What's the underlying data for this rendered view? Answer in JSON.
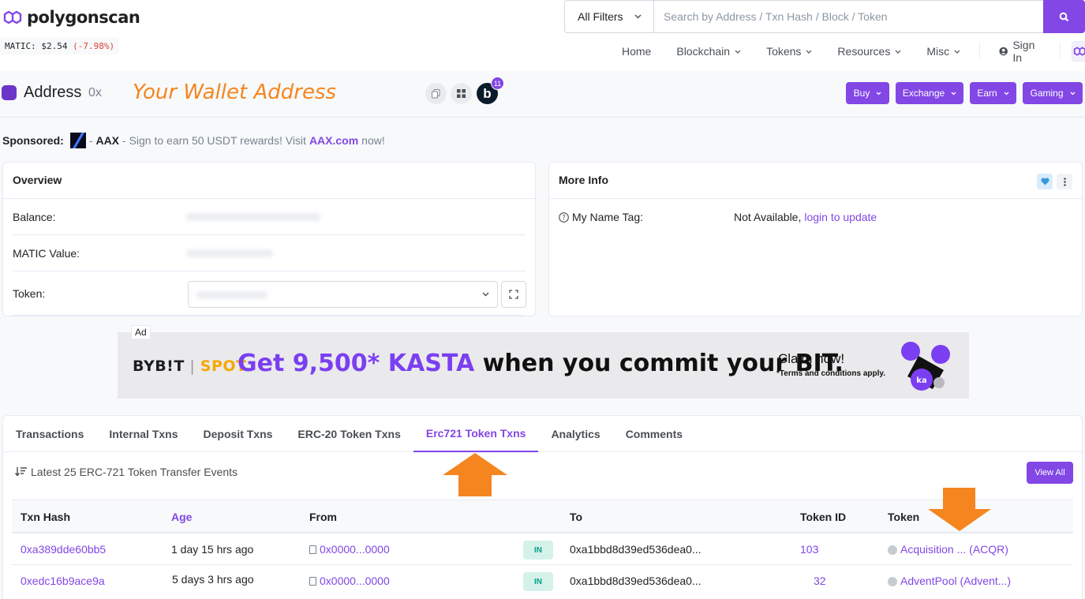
{
  "header": {
    "logo_text": "polygonscan",
    "price_label": "MATIC: $2.54",
    "price_change": "(-7.98%)",
    "filter_label": "All Filters",
    "search_placeholder": "Search by Address / Txn Hash / Block / Token",
    "nav": [
      {
        "label": "Home"
      },
      {
        "label": "Blockchain"
      },
      {
        "label": "Tokens"
      },
      {
        "label": "Resources"
      },
      {
        "label": "Misc"
      }
    ],
    "sign_in": "Sign In"
  },
  "title": {
    "label": "Address",
    "hash_prefix": "0x",
    "annotation": "Your Wallet Address",
    "blockscan_letter": "b",
    "blockscan_badge": "11",
    "buttons": [
      "Buy",
      "Exchange",
      "Earn",
      "Gaming"
    ]
  },
  "sponsored": {
    "label": "Sponsored:",
    "brand": "AAX",
    "text": "- Sign to earn 50 USDT rewards! Visit",
    "link": "AAX.com",
    "suffix": "now!"
  },
  "overview": {
    "title": "Overview",
    "balance_label": "Balance:",
    "matic_value_label": "MATIC Value:",
    "token_label": "Token:"
  },
  "more_info": {
    "title": "More Info",
    "name_tag_label": "My Name Tag:",
    "name_tag_value": "Not Available,",
    "name_tag_link": "login to update"
  },
  "ad": {
    "label": "Ad",
    "brand": "BYB!T",
    "brand_sub": "SPOT",
    "headline_highlight": "Get 9,500* KASTA",
    "headline_rest": "when you commit your BIT.",
    "claim": "Claim now!",
    "terms": "*Terms and conditions apply."
  },
  "tabs": [
    {
      "label": "Transactions",
      "active": false
    },
    {
      "label": "Internal Txns",
      "active": false
    },
    {
      "label": "Deposit Txns",
      "active": false
    },
    {
      "label": "ERC-20 Token Txns",
      "active": false
    },
    {
      "label": "Erc721 Token Txns",
      "active": true
    },
    {
      "label": "Analytics",
      "active": false
    },
    {
      "label": "Comments",
      "active": false
    }
  ],
  "table": {
    "caption": "Latest 25 ERC-721 Token Transfer Events",
    "view_all": "View All",
    "columns": [
      "Txn Hash",
      "Age",
      "From",
      "To",
      "Token ID",
      "Token"
    ],
    "rows": [
      {
        "hash": "0xa389dde60bb5",
        "age": "1 day 15 hrs ago",
        "from": "0x0000...0000",
        "direction": "IN",
        "to": "0xa1bbd8d39ed536dea0...",
        "token_id": "103",
        "token": "Acquisition ... (ACQR)"
      },
      {
        "hash": "0xedc16b9ace9a",
        "age": "5 days 3 hrs ago",
        "from": "0x0000...0000",
        "direction": "IN",
        "to": "0xa1bbd8d39ed536dea0...",
        "token_id": "32",
        "token": "AdventPool (Advent...)"
      }
    ]
  },
  "colors": {
    "brand": "#8247e5",
    "annotation": "#f5851f",
    "negative": "#de4437",
    "in_badge": "#00a186"
  }
}
